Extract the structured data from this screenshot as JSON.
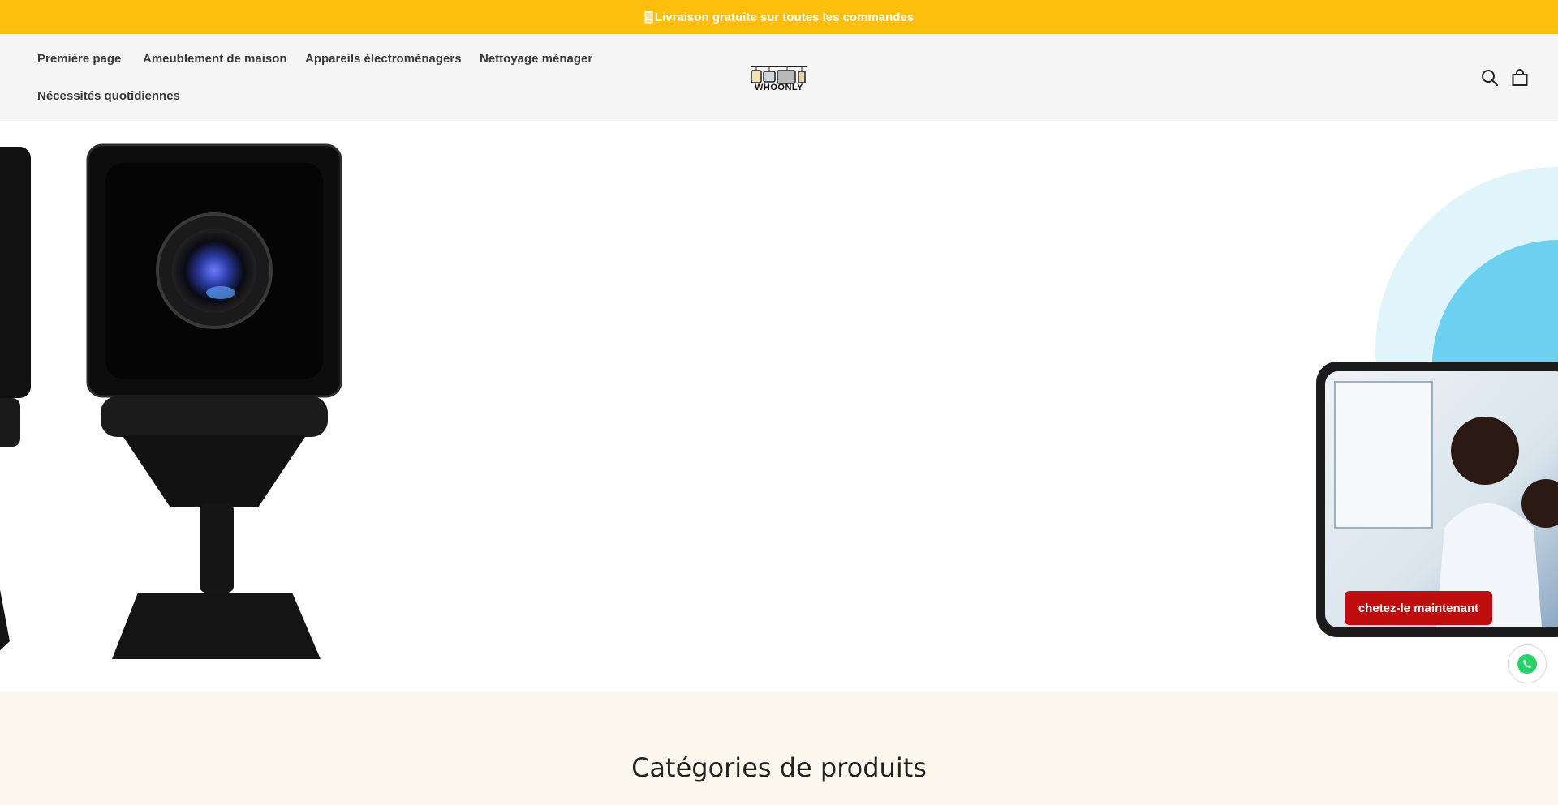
{
  "announcement": {
    "text": "Livraison gratuite sur toutes les commandes",
    "icon": "receipt-icon"
  },
  "nav": {
    "items": [
      {
        "label": "Première page"
      },
      {
        "label": "Ameublement de maison"
      },
      {
        "label": "Appareils électroménagers"
      },
      {
        "label": "Nettoyage ménager"
      },
      {
        "label": "Nécessités quotidiennes"
      }
    ]
  },
  "logo": {
    "text": "WHOONLY"
  },
  "header_icons": {
    "search": "search-icon",
    "cart": "shopping-bag-icon"
  },
  "hero": {
    "cta_label": "chetez-le maintenant"
  },
  "chat": {
    "icon": "whatsapp-icon"
  },
  "categories": {
    "title": "Catégories de produits"
  },
  "colors": {
    "announcement_bg": "#fcbf0b",
    "header_bg": "#f5f5f5",
    "cta_bg": "#c00d0d",
    "categories_bg": "#fbf7ec",
    "whatsapp": "#25d366"
  }
}
